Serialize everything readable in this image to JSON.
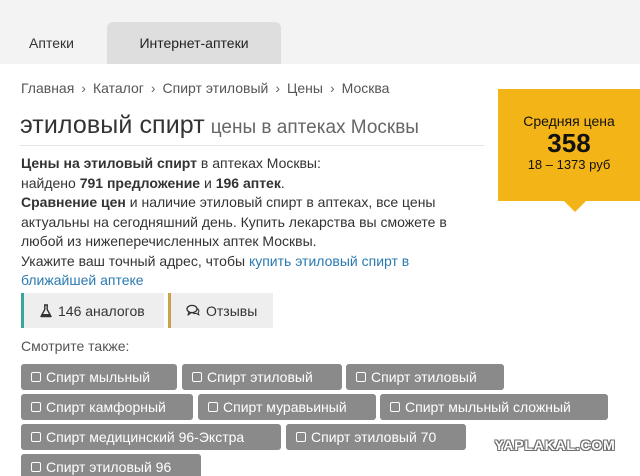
{
  "tabs": [
    {
      "label": "Аптеки",
      "active": true
    },
    {
      "label": "Интернет-аптеки",
      "active": false
    }
  ],
  "breadcrumb": [
    "Главная",
    "Каталог",
    "Спирт этиловый",
    "Цены",
    "Москва"
  ],
  "breadcrumb_separator": "›",
  "title": {
    "main": "этиловый спирт",
    "sub": "цены в аптеках Москвы"
  },
  "description": {
    "line1_bold": "Цены на этиловый спирт",
    "line1_rest": " в аптеках Москвы:",
    "line2_prefix": "найдено ",
    "offers_count": "791 предложение",
    "line2_and": " и ",
    "pharmacies_count": "196 аптек",
    "line2_end": ".",
    "compare_bold": "Сравнение цен",
    "compare_rest": " и наличие этиловый спирт в аптеках, все цены актуальны на сегодняшний день. Купить лекарства вы сможете в любой из нижеперечисленных аптек Москвы.",
    "address_prefix": "Укажите ваш точный адрес, чтобы ",
    "address_link": "купить этиловый спирт в ближайшей аптеке"
  },
  "price_box": {
    "label": "Средняя цена",
    "value": "358",
    "range": "18 – 1373 руб"
  },
  "buttons": {
    "analogs": "146 аналогов",
    "reviews": "Отзывы"
  },
  "see_also": {
    "label": "Смотрите также:",
    "items": [
      "Спирт мыльный",
      "Спирт этиловый",
      "Спирт этиловый",
      "Спирт камфорный",
      "Спирт муравьиный",
      "Спирт мыльный сложный",
      "Спирт медицинский 96-Экстра",
      "Спирт этиловый 70",
      "Спирт этиловый 96"
    ]
  },
  "watermark": "YAPLAKAL.COM",
  "colors": {
    "accent_yellow": "#f2b417",
    "chip_gray": "#8a8a8a",
    "link_blue": "#2a7ab0",
    "teal": "#3aa69c"
  }
}
